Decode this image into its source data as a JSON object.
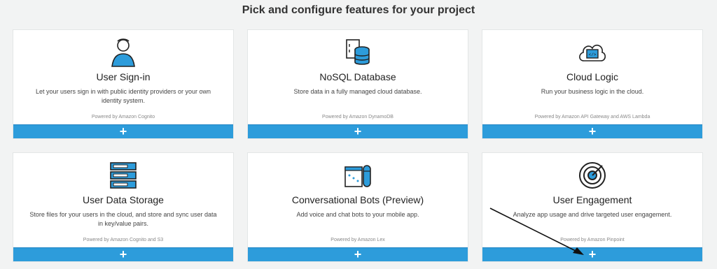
{
  "heading": "Pick and configure features for your project",
  "cards": [
    {
      "title": "User Sign-in",
      "desc": "Let your users sign in with public identity providers or your own identity system.",
      "powered": "Powered by Amazon Cognito",
      "add": "+"
    },
    {
      "title": "NoSQL Database",
      "desc": "Store data in a fully managed cloud database.",
      "powered": "Powered by Amazon DynamoDB",
      "add": "+"
    },
    {
      "title": "Cloud Logic",
      "desc": "Run your business logic in the cloud.",
      "powered": "Powered by Amazon API Gateway and AWS Lambda",
      "add": "+"
    },
    {
      "title": "User Data Storage",
      "desc": "Store files for your users in the cloud, and store and sync user data in key/value pairs.",
      "powered": "Powered by Amazon Cognito and S3",
      "add": "+"
    },
    {
      "title": "Conversational Bots (Preview)",
      "desc": "Add voice and chat bots to your mobile app.",
      "powered": "Powered by Amazon Lex",
      "add": "+"
    },
    {
      "title": "User Engagement",
      "desc": "Analyze app usage and drive targeted user engagement.",
      "powered": "Powered by Amazon Pinpoint",
      "add": "+"
    }
  ],
  "icons": [
    "user-icon",
    "database-icon",
    "cloud-logic-icon",
    "server-storage-icon",
    "chat-bot-icon",
    "target-icon"
  ],
  "colors": {
    "accent": "#2d9cdb",
    "background": "#f2f3f3"
  }
}
